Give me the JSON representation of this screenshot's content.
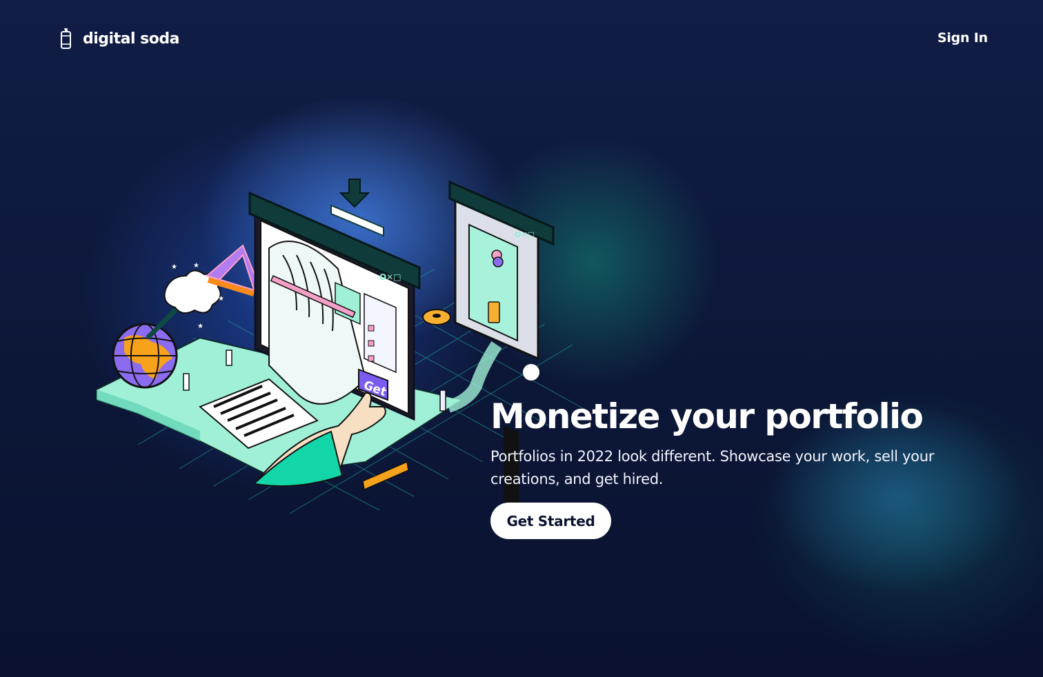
{
  "header": {
    "brand": "digital soda",
    "sign_in": "Sign In"
  },
  "hero": {
    "title": "Monetize your portfolio",
    "subtitle": "Portfolios in 2022 look different. Showcase your work, sell your creations, and get hired.",
    "cta": "Get Started"
  },
  "illustration": {
    "button_label": "Get"
  },
  "colors": {
    "background": "#0c1533",
    "accent_mint": "#9ff0d6",
    "accent_green": "#12d6a8",
    "accent_purple": "#8b6cf0",
    "accent_orange": "#f7a21b",
    "button_bg": "#ffffff"
  },
  "icons": [
    "soda-bottle-icon",
    "download-arrow-icon"
  ]
}
